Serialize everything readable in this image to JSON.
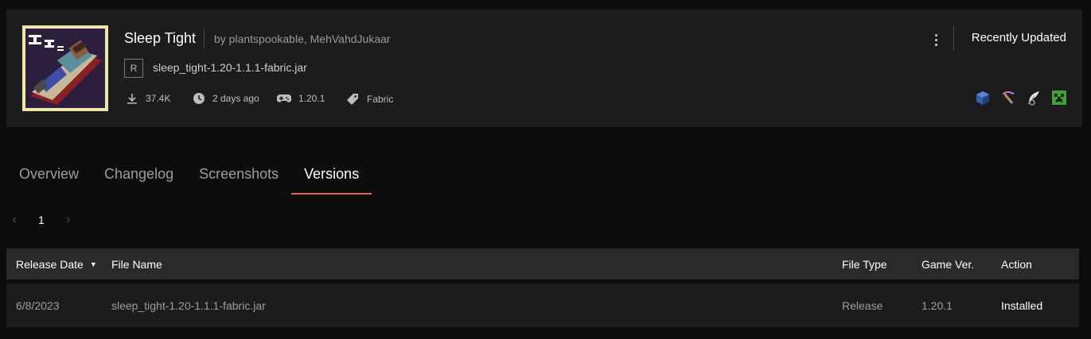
{
  "mod": {
    "title": "Sleep Tight",
    "authors": "by plantspookable, MehVahdJukaar",
    "release_badge": "R",
    "file_name": "sleep_tight-1.20-1.1.1-fabric.jar",
    "downloads": "37.4K",
    "updated": "2 days ago",
    "game_version": "1.20.1",
    "loader": "Fabric",
    "sort_label": "Recently Updated",
    "category_icons": [
      "blue-cube-icon",
      "pickaxe-icon",
      "feather-icon",
      "creeper-icon"
    ]
  },
  "tabs": [
    "Overview",
    "Changelog",
    "Screenshots",
    "Versions"
  ],
  "active_tab": "Versions",
  "pagination": {
    "current": "1"
  },
  "table": {
    "columns": [
      "Release Date",
      "File Name",
      "File Type",
      "Game Ver.",
      "Action"
    ],
    "rows": [
      {
        "release_date": "6/8/2023",
        "file_name": "sleep_tight-1.20-1.1.1-fabric.jar",
        "file_type": "Release",
        "game_ver": "1.20.1",
        "action": "Installed"
      }
    ]
  },
  "colors": {
    "accent": "#e8644a",
    "background": "#0d0d0d",
    "card": "#1c1c1c"
  }
}
